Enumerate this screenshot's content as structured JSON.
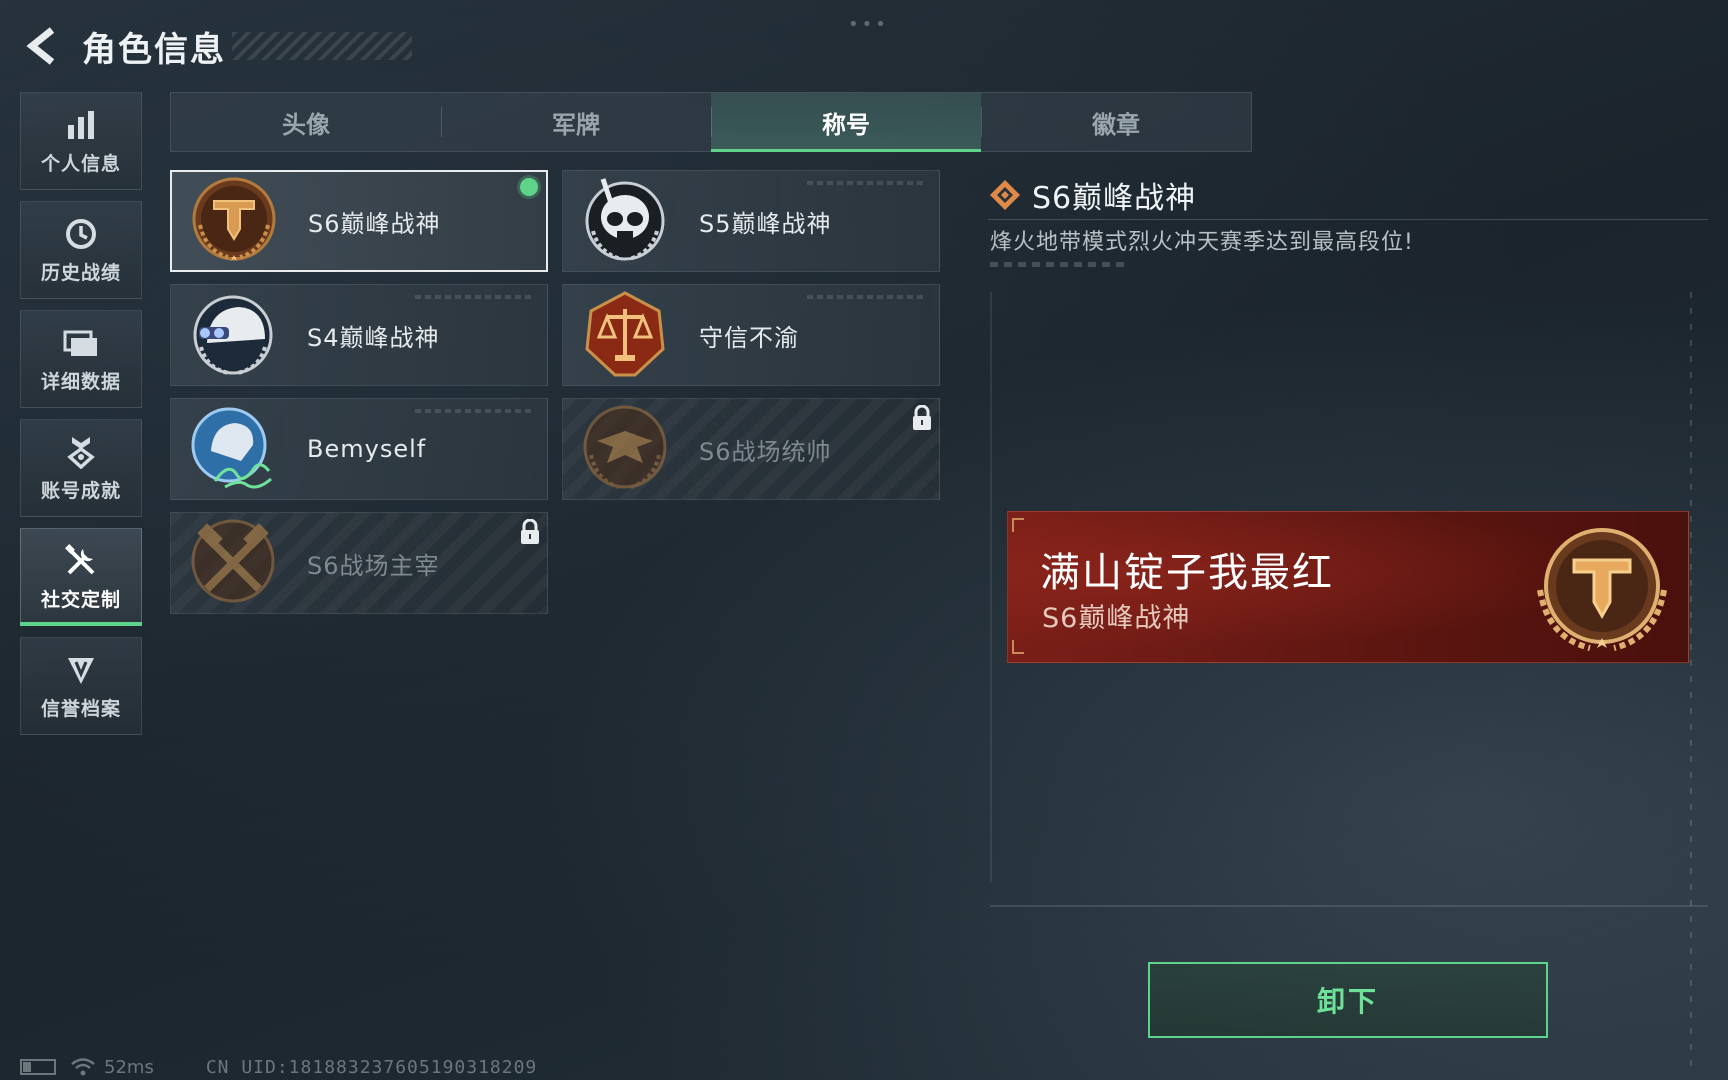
{
  "header": {
    "title": "角色信息"
  },
  "top_indicator": "•••",
  "sidebar": {
    "items": [
      {
        "label": "个人信息",
        "icon": "bar-chart-icon",
        "active": false
      },
      {
        "label": "历史战绩",
        "icon": "clock-icon",
        "active": false
      },
      {
        "label": "详细数据",
        "icon": "folder-icon",
        "active": false
      },
      {
        "label": "账号成就",
        "icon": "medal-icon",
        "active": false
      },
      {
        "label": "社交定制",
        "icon": "tools-icon",
        "active": true
      },
      {
        "label": "信誉档案",
        "icon": "shield-icon",
        "active": false
      }
    ]
  },
  "tabs": [
    {
      "label": "头像",
      "active": false
    },
    {
      "label": "军牌",
      "active": false
    },
    {
      "label": "称号",
      "active": true
    },
    {
      "label": "徽章",
      "active": false
    }
  ],
  "titles": [
    {
      "label": "S6巅峰战神",
      "medal": "s6-peak-medal-icon",
      "selected": true,
      "equipped": true,
      "locked": false
    },
    {
      "label": "S5巅峰战神",
      "medal": "skull-medal-icon",
      "selected": false,
      "equipped": false,
      "locked": false
    },
    {
      "label": "S4巅峰战神",
      "medal": "helmet-medal-icon",
      "selected": false,
      "equipped": false,
      "locked": false
    },
    {
      "label": "守信不渝",
      "medal": "scales-medal-icon",
      "selected": false,
      "equipped": false,
      "locked": false
    },
    {
      "label": "Bemyself",
      "medal": "signature-medal-icon",
      "selected": false,
      "equipped": false,
      "locked": false
    },
    {
      "label": "S6战场统帅",
      "medal": "eagle-medal-icon",
      "selected": false,
      "equipped": false,
      "locked": true
    },
    {
      "label": "S6战场主宰",
      "medal": "crossed-hammers-medal-icon",
      "selected": false,
      "equipped": false,
      "locked": true
    }
  ],
  "detail": {
    "title": "S6巅峰战神",
    "description": "烽火地带模式烈火冲天赛季达到最高段位!"
  },
  "preview": {
    "player_name": "满山锭子我最红",
    "title": "S6巅峰战神"
  },
  "action": {
    "unequip_label": "卸下"
  },
  "status_bar": {
    "ping": "52ms",
    "uid": "CN UID:1818832376051903182​09"
  },
  "colors": {
    "accent_green": "#5fd38a",
    "banner_red": "#7a1f18",
    "medal_gold": "#c9904a"
  }
}
